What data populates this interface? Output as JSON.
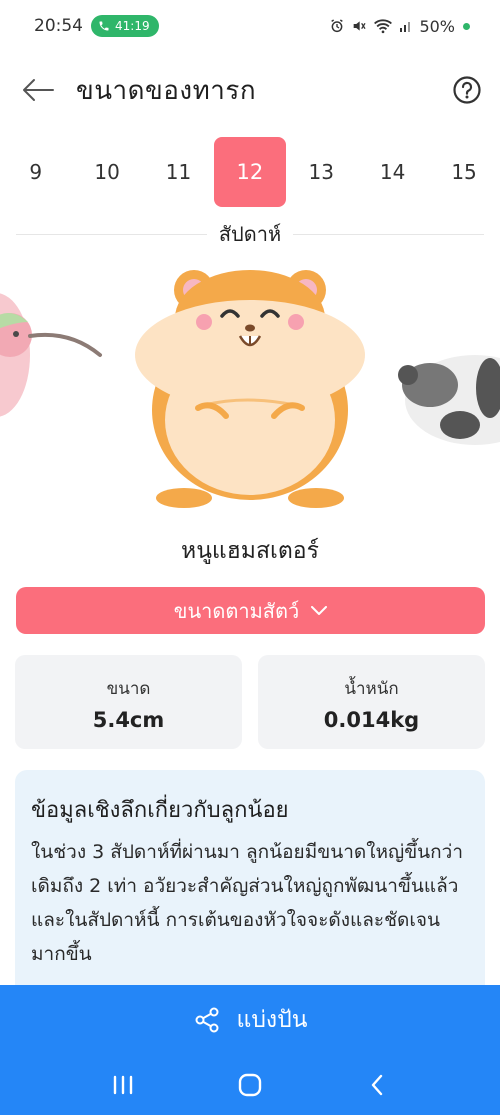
{
  "status_bar": {
    "time": "20:54",
    "call_duration": "41:19",
    "battery": "50%"
  },
  "header": {
    "title": "ขนาดของทารก",
    "back_icon": "arrow-left-icon",
    "help_icon": "question-circle-icon"
  },
  "weeks": {
    "items": [
      "9",
      "10",
      "11",
      "12",
      "13",
      "14",
      "15"
    ],
    "selected": "12",
    "caption": "สัปดาห์"
  },
  "animal": {
    "name": "หนูแฮมสเตอร์",
    "illustrations": [
      "hummingbird-partial",
      "hamster",
      "panda-partial"
    ]
  },
  "size_dropdown": {
    "label": "ขนาดตามสัตว์"
  },
  "stats": {
    "size": {
      "label": "ขนาด",
      "value": "5.4cm"
    },
    "weight": {
      "label": "น้ำหนัก",
      "value": "0.014kg"
    }
  },
  "insight": {
    "title": "ข้อมูลเชิงลึกเกี่ยวกับลูกน้อย",
    "body": "ในช่วง 3 สัปดาห์ที่ผ่านมา ลูกน้อยมีขนาดใหญ่ขึ้นกว่าเดิมถึง 2 เท่า อวัยวะสำคัญส่วนใหญ่ถูกพัฒนาขึ้นแล้ว และในสัปดาห์นี้ การเต้นของหัวใจจะดังและชัดเจนมากขึ้น"
  },
  "share": {
    "label": "แบ่งปัน",
    "icon": "share-icon"
  },
  "colors": {
    "accent": "#fb6e7c",
    "share_bar": "#2486f7",
    "card_bg": "#f2f3f5",
    "insight_bg": "#e9f3fb"
  }
}
